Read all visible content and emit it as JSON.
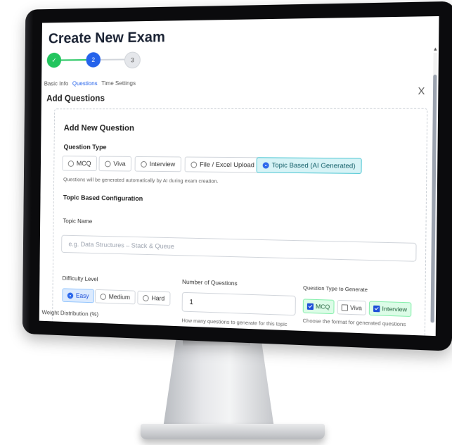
{
  "modal": {
    "title": "Create New Exam",
    "close_label": "X",
    "steps": [
      {
        "number": "✓",
        "label": "Basic Info",
        "state": "done"
      },
      {
        "number": "2",
        "label": "Questions",
        "state": "active"
      },
      {
        "number": "3",
        "label": "Time Settings",
        "state": "pending"
      }
    ],
    "section_heading": "Add Questions"
  },
  "form": {
    "heading": "Add New Question",
    "question_type_label": "Question Type",
    "question_types": [
      "MCQ",
      "Viva",
      "Interview",
      "File / Excel Upload",
      "Topic Based (AI Generated)"
    ],
    "selected_type": "Topic Based (AI Generated)",
    "ai_hint": "Questions will be generated automatically by AI during exam creation.",
    "topic_config_label": "Topic Based Configuration",
    "topic_name_label": "Topic Name",
    "topic_placeholder": "e.g. Data Structures – Stack & Queue",
    "difficulty_label": "Difficulty Level",
    "difficulty_options": [
      "Easy",
      "Medium",
      "Hard"
    ],
    "selected_difficulty": "Easy",
    "num_questions_label": "Number of Questions",
    "num_questions_value": "1",
    "num_questions_hint": "How many questions to generate for this topic",
    "gen_type_label": "Question Type to Generate",
    "gen_types": [
      {
        "label": "MCQ",
        "checked": true
      },
      {
        "label": "Viva",
        "checked": false
      },
      {
        "label": "Interview",
        "checked": true
      }
    ],
    "gen_type_hint": "Choose the format for generated questions",
    "weight_label": "Weight Distribution (%)"
  },
  "colors": {
    "step_done": "#22c55e",
    "step_active": "#2563eb",
    "selected_type_bg": "#d7f3f6",
    "checked_bg": "#dcfce7"
  }
}
